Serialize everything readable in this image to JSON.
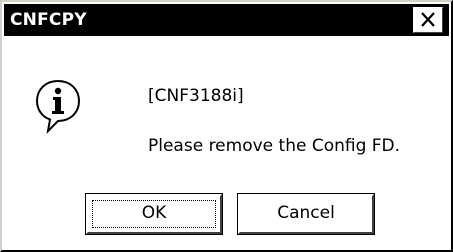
{
  "window": {
    "title": "CNFCPY",
    "close_glyph": "✕"
  },
  "message": {
    "icon": "info-icon",
    "code": "[CNF3188i]",
    "text": "Please remove the Config FD."
  },
  "buttons": {
    "ok_label": "OK",
    "cancel_label": "Cancel"
  },
  "colors": {
    "titlebar_bg": "#000000",
    "titlebar_text": "#ffffff",
    "dialog_bg": "#ffffff"
  }
}
